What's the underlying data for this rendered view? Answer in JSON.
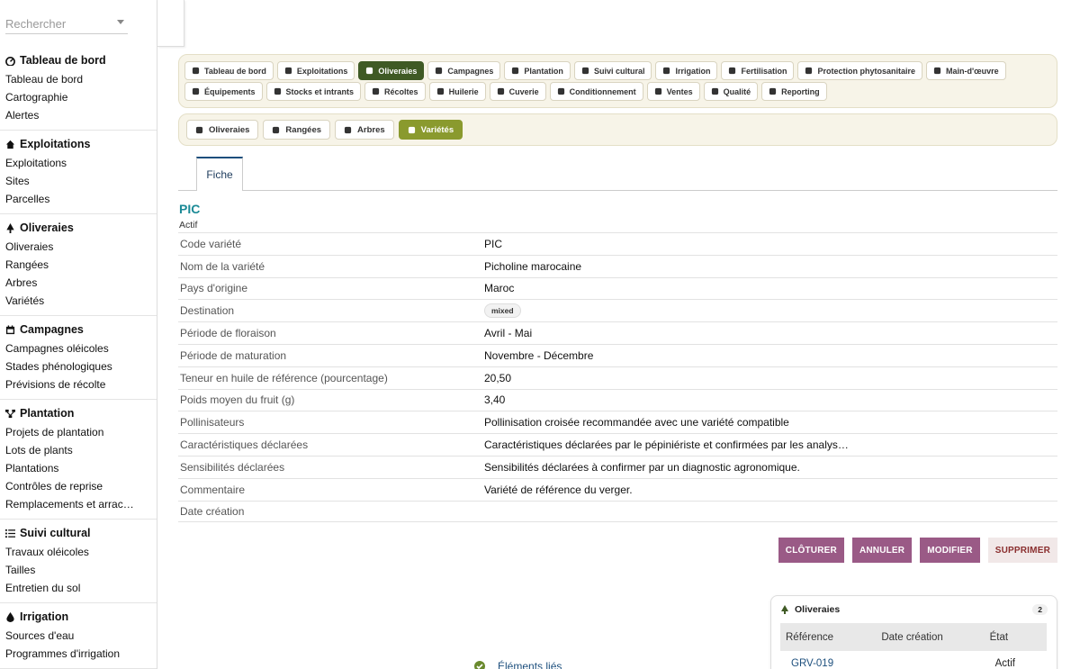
{
  "search": {
    "placeholder": "Rechercher"
  },
  "sidebar": {
    "groups": [
      {
        "title": "Tableau de bord",
        "icon": "dashboard-icon",
        "items": [
          "Tableau de bord",
          "Cartographie",
          "Alertes"
        ]
      },
      {
        "title": "Exploitations",
        "icon": "home-icon",
        "items": [
          "Exploitations",
          "Sites",
          "Parcelles"
        ]
      },
      {
        "title": "Oliveraies",
        "icon": "tree-icon",
        "items": [
          "Oliveraies",
          "Rangées",
          "Arbres",
          "Variétés"
        ]
      },
      {
        "title": "Campagnes",
        "icon": "calendar-icon",
        "items": [
          "Campagnes oléicoles",
          "Stades phénologiques",
          "Prévisions de récolte"
        ]
      },
      {
        "title": "Plantation",
        "icon": "sitemap-icon",
        "items": [
          "Projets de plantation",
          "Lots de plants",
          "Plantations",
          "Contrôles de reprise",
          "Remplacements et arrac…"
        ]
      },
      {
        "title": "Suivi cultural",
        "icon": "list-icon",
        "items": [
          "Travaux oléicoles",
          "Tailles",
          "Entretien du sol"
        ]
      },
      {
        "title": "Irrigation",
        "icon": "droplet-icon",
        "items": [
          "Sources d'eau",
          "Programmes d'irrigation"
        ]
      }
    ]
  },
  "modules": {
    "row1": [
      "Tableau de bord",
      "Exploitations",
      "Oliveraies",
      "Campagnes",
      "Plantation",
      "Suivi cultural",
      "Irrigation",
      "Fertilisation",
      "Protection phytosanitaire",
      "Main-d'œuvre"
    ],
    "row2": [
      "Équipements",
      "Stocks et intrants",
      "Récoltes",
      "Huilerie",
      "Cuverie",
      "Conditionnement",
      "Ventes",
      "Qualité",
      "Reporting"
    ],
    "active": "Oliveraies"
  },
  "submodules": {
    "items": [
      "Oliveraies",
      "Rangées",
      "Arbres",
      "Variétés"
    ],
    "active": "Variétés"
  },
  "tabs": {
    "fiche": "Fiche"
  },
  "record": {
    "title": "PIC",
    "status": "Actif",
    "fields": [
      {
        "label": "Code variété",
        "value": "PIC"
      },
      {
        "label": "Nom de la variété",
        "value": "Picholine marocaine"
      },
      {
        "label": "Pays d'origine",
        "value": "Maroc"
      },
      {
        "label": "Destination",
        "value": "mixed"
      },
      {
        "label": "Période de floraison",
        "value": "Avril - Mai"
      },
      {
        "label": "Période de maturation",
        "value": "Novembre - Décembre"
      },
      {
        "label": "Teneur en huile de référence (pourcentage)",
        "value": "20,50"
      },
      {
        "label": "Poids moyen du fruit (g)",
        "value": "3,40"
      },
      {
        "label": "Pollinisateurs",
        "value": "Pollinisation croisée recommandée avec une variété compatible"
      },
      {
        "label": "Caractéristiques déclarées",
        "value": "Caractéristiques déclarées par le pépiniériste et confirmées par les analyses de…"
      },
      {
        "label": "Sensibilités déclarées",
        "value": "Sensibilités déclarées à confirmer par un diagnostic agronomique."
      },
      {
        "label": "Commentaire",
        "value": "Variété de référence du verger."
      },
      {
        "label": "Date création",
        "value": ""
      }
    ]
  },
  "actions": {
    "close": "CLÔTURER",
    "cancel": "ANNULER",
    "edit": "MODIFIER",
    "delete": "SUPPRIMER"
  },
  "linked": {
    "label": "Éléments liés"
  },
  "panel": {
    "title": "Oliveraies",
    "count": "2",
    "columns": [
      "Référence",
      "Date création",
      "État"
    ],
    "rows": [
      {
        "ref": "GRV-019",
        "date": "",
        "state": "Actif"
      }
    ]
  },
  "colors": {
    "accent": "#3f5a25",
    "sub_active": "#8a9a2e",
    "title": "#1b8a96",
    "action": "#9a5a86"
  }
}
